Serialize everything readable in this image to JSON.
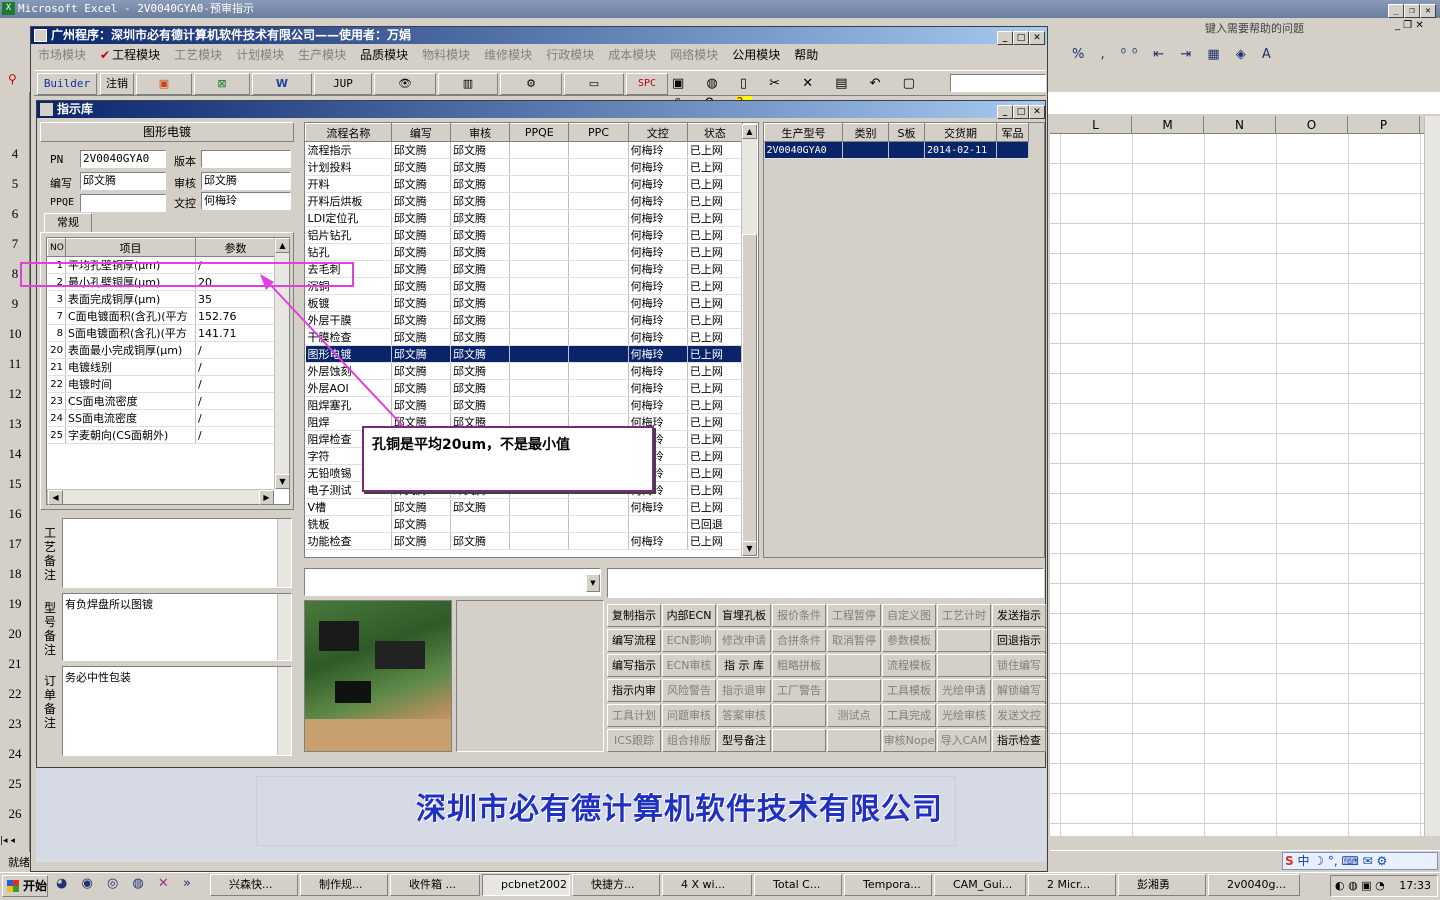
{
  "excel": {
    "title": "Microsoft Excel - 2V0040GYA0-预审指示",
    "help_placeholder": "键入需要帮助的问题",
    "cols": [
      "L",
      "M",
      "N",
      "O",
      "P"
    ],
    "rows": [
      "4",
      "5",
      "6",
      "7",
      "8",
      "9",
      "10",
      "11",
      "12",
      "13",
      "14",
      "15",
      "16",
      "17",
      "18",
      "19",
      "20",
      "21",
      "22",
      "23",
      "24",
      "25",
      "26"
    ],
    "status": "就绪"
  },
  "app": {
    "title": "广州程序：深圳市必有德计算机软件技术有限公司——使用者：万娟",
    "menu": [
      "市场模块",
      "工程模块",
      "工艺模块",
      "计划模块",
      "生产模块",
      "品质模块",
      "物料模块",
      "维修模块",
      "行政模块",
      "成本模块",
      "网络模块",
      "公用模块",
      "帮助"
    ],
    "toolbar": [
      "Builder",
      "注销",
      "JUP",
      "SPC"
    ]
  },
  "child": {
    "title": "指示库",
    "section": "图形电镀",
    "fields": {
      "pn_label": "PN",
      "pn": "2V0040GYA0",
      "ver_label": "版本",
      "ver": "",
      "author_label": "编写",
      "author": "邱文腾",
      "review_label": "审核",
      "review": "邱文腾",
      "ppqe_label": "PPQE",
      "ppqe": "",
      "doc_label": "文控",
      "doc": "何梅玲"
    },
    "tab": "常规",
    "params_headers": [
      "NO",
      "项目",
      "参数"
    ],
    "params": [
      [
        "1",
        "平均孔壁铜厚(μm)",
        "/"
      ],
      [
        "2",
        "最小孔壁铜厚(μm)",
        "20"
      ],
      [
        "3",
        "表面完成铜厚(μm)",
        "35"
      ],
      [
        "7",
        "C面电镀面积(含孔)(平方",
        "152.76"
      ],
      [
        "8",
        "S面电镀面积(含孔)(平方",
        "141.71"
      ],
      [
        "20",
        "表面最小完成铜厚(μm)",
        "/"
      ],
      [
        "21",
        "电镀线别",
        "/"
      ],
      [
        "22",
        "电镀时间",
        "/"
      ],
      [
        "23",
        "CS面电流密度",
        "/"
      ],
      [
        "24",
        "SS面电流密度",
        "/"
      ],
      [
        "25",
        "字麦朝向(CS面朝外)",
        "/"
      ]
    ],
    "notes": [
      {
        "label": "工艺备注",
        "text": ""
      },
      {
        "label": "型号备注",
        "text": "有负焊盘所以图镀"
      },
      {
        "label": "订单备注",
        "text": "务必中性包装"
      }
    ],
    "flow_headers": [
      "流程名称",
      "编写",
      "审核",
      "PPQE",
      "PPC",
      "文控",
      "状态"
    ],
    "flow": [
      [
        "流程指示",
        "邱文腾",
        "邱文腾",
        "",
        "",
        "何梅玲",
        "已上网"
      ],
      [
        "计划投料",
        "邱文腾",
        "邱文腾",
        "",
        "",
        "何梅玲",
        "已上网"
      ],
      [
        "开料",
        "邱文腾",
        "邱文腾",
        "",
        "",
        "何梅玲",
        "已上网"
      ],
      [
        "开料后烘板",
        "邱文腾",
        "邱文腾",
        "",
        "",
        "何梅玲",
        "已上网"
      ],
      [
        "LDI定位孔",
        "邱文腾",
        "邱文腾",
        "",
        "",
        "何梅玲",
        "已上网"
      ],
      [
        "铝片钻孔",
        "邱文腾",
        "邱文腾",
        "",
        "",
        "何梅玲",
        "已上网"
      ],
      [
        "钻孔",
        "邱文腾",
        "邱文腾",
        "",
        "",
        "何梅玲",
        "已上网"
      ],
      [
        "去毛刺",
        "邱文腾",
        "邱文腾",
        "",
        "",
        "何梅玲",
        "已上网"
      ],
      [
        "沉铜",
        "邱文腾",
        "邱文腾",
        "",
        "",
        "何梅玲",
        "已上网"
      ],
      [
        "板镀",
        "邱文腾",
        "邱文腾",
        "",
        "",
        "何梅玲",
        "已上网"
      ],
      [
        "外层干膜",
        "邱文腾",
        "邱文腾",
        "",
        "",
        "何梅玲",
        "已上网"
      ],
      [
        "干膜检查",
        "邱文腾",
        "邱文腾",
        "",
        "",
        "何梅玲",
        "已上网"
      ],
      [
        "图形电镀",
        "邱文腾",
        "邱文腾",
        "",
        "",
        "何梅玲",
        "已上网"
      ],
      [
        "外层蚀刻",
        "邱文腾",
        "邱文腾",
        "",
        "",
        "何梅玲",
        "已上网"
      ],
      [
        "外层AOI",
        "邱文腾",
        "邱文腾",
        "",
        "",
        "何梅玲",
        "已上网"
      ],
      [
        "阻焊塞孔",
        "邱文腾",
        "邱文腾",
        "",
        "",
        "何梅玲",
        "已上网"
      ],
      [
        "阻焊",
        "邱文腾",
        "邱文腾",
        "",
        "",
        "何梅玲",
        "已上网"
      ],
      [
        "阻焊检查",
        "邱文腾",
        "邱文腾",
        "",
        "",
        "何梅玲",
        "已上网"
      ],
      [
        "字符",
        "邱文腾",
        "邱文腾",
        "",
        "",
        "何梅玲",
        "已上网"
      ],
      [
        "无铅喷锡",
        "邱文腾",
        "邱文腾",
        "",
        "",
        "何梅玲",
        "已上网"
      ],
      [
        "电子测试",
        "邱文腾",
        "邱文腾",
        "",
        "",
        "何梅玲",
        "已上网"
      ],
      [
        "V槽",
        "邱文腾",
        "邱文腾",
        "",
        "",
        "何梅玲",
        "已上网"
      ],
      [
        "铣板",
        "邱文腾",
        "",
        "",
        "",
        "",
        "已回退"
      ],
      [
        "功能检查",
        "邱文腾",
        "邱文腾",
        "",
        "",
        "何梅玲",
        "已上网"
      ]
    ],
    "prod_headers": [
      "生产型号",
      "类别",
      "S板",
      "交货期",
      "军品"
    ],
    "prod": [
      [
        "2V0040GYA0",
        "",
        "",
        "2014-02-11",
        ""
      ]
    ],
    "buttons": [
      [
        "复制指示",
        "内部ECN",
        "盲埋孔板",
        "报价条件",
        "工程暂停",
        "自定义图",
        "工艺计时",
        "发送指示"
      ],
      [
        "编写流程",
        "ECN影响",
        "修改申请",
        "合拼条件",
        "取消暂停",
        "参数模板",
        "",
        "回退指示"
      ],
      [
        "编写指示",
        "ECN审核",
        "指 示 库",
        "粗略拼板",
        "",
        "流程模板",
        "",
        "锁住编写"
      ],
      [
        "指示内审",
        "风险警告",
        "指示退审",
        "工厂警告",
        "",
        "工具模板",
        "光绘申请",
        "解锁编写"
      ],
      [
        "工具计划",
        "问题审核",
        "答案审核",
        "",
        "测试点",
        "工具完成",
        "光绘审核",
        "发送文控"
      ],
      [
        "ICS跟踪",
        "组合排版",
        "型号备注",
        "",
        "",
        "审核Nope",
        "导入CAM",
        "指示检查"
      ]
    ],
    "buttons_enabled": [
      [
        "复制指示",
        "内部ECN",
        "盲埋孔板",
        "发送指示"
      ],
      [
        "编写流程",
        "回退指示"
      ],
      [
        "编写指示",
        "指 示 库"
      ],
      [
        "指示内审"
      ],
      [],
      [
        "型号备注",
        "指示检查"
      ]
    ],
    "company": "深圳市必有德计算机软件技术有限公司"
  },
  "annotation": {
    "text": "孔铜是平均20um，不是最小值"
  },
  "taskbar": {
    "start": "开始",
    "items": [
      "兴森快...",
      "制作规...",
      "收件箱 ...",
      "pcbnet2002",
      "快捷方...",
      "4 X wi...",
      "Total C...",
      "Tempora...",
      "CAM_Gui...",
      "2 Micr...",
      "彭湘勇",
      "2v0040g..."
    ],
    "clock": "17:33"
  }
}
